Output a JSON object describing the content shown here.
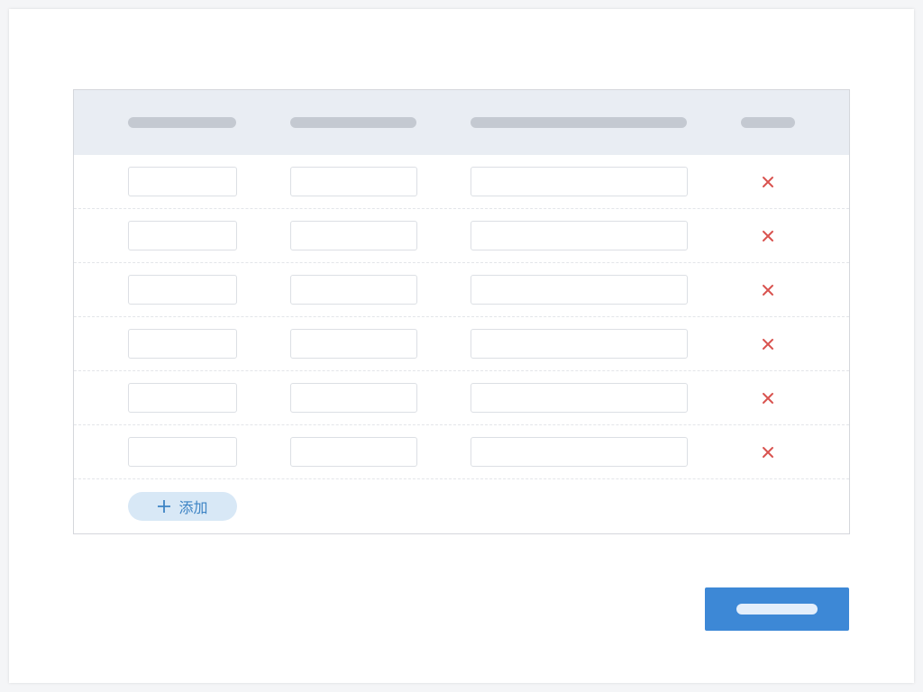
{
  "table": {
    "rows": [
      {
        "col1": "",
        "col2": "",
        "col3": ""
      },
      {
        "col1": "",
        "col2": "",
        "col3": ""
      },
      {
        "col1": "",
        "col2": "",
        "col3": ""
      },
      {
        "col1": "",
        "col2": "",
        "col3": ""
      },
      {
        "col1": "",
        "col2": "",
        "col3": ""
      },
      {
        "col1": "",
        "col2": "",
        "col3": ""
      }
    ],
    "delete_icon": "close-icon",
    "add_label": "添加",
    "add_icon": "plus-icon"
  },
  "colors": {
    "header_bg": "#e9edf3",
    "placeholder_bar": "#c4c9d1",
    "delete_red": "#d9534f",
    "add_bg": "#d8e8f6",
    "add_text": "#3c83c4",
    "primary": "#3d88d6"
  }
}
